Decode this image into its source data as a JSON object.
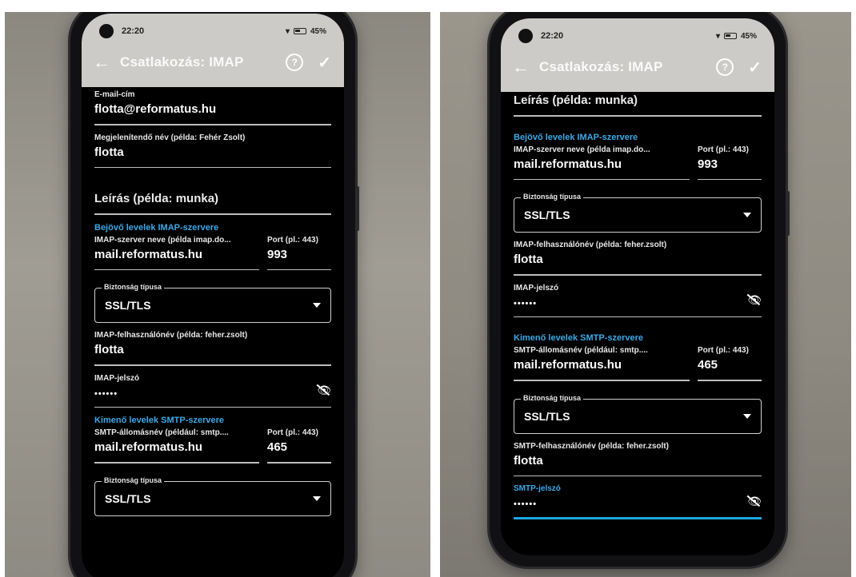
{
  "app": {
    "time": "22:20",
    "battery": "45%",
    "title": "Csatlakozás: IMAP"
  },
  "fields": {
    "email_label": "E-mail-cím",
    "email_value": "flotta@reformatus.hu",
    "display_name_label": "Megjelenítendő név (példa: Fehér Zsolt)",
    "display_name_value": "flotta",
    "description_placeholder": "Leírás (példa: munka)"
  },
  "incoming": {
    "section_title": "Bejövő levelek IMAP-szervere",
    "server_label": "IMAP-szerver neve (példa imap.do...",
    "server_value": "mail.reformatus.hu",
    "port_label": "Port (pl.: 443)",
    "port_value": "993",
    "security_legend": "Biztonság típusa",
    "security_value": "SSL/TLS",
    "username_label": "IMAP-felhasználónév (példa: feher.zsolt)",
    "username_value": "flotta",
    "password_label": "IMAP-jelszó",
    "password_dots": "••••••"
  },
  "outgoing": {
    "section_title": "Kimenő levelek SMTP-szervere",
    "server_label": "SMTP-állomásnév (például: smtp....",
    "server_value": "mail.reformatus.hu",
    "port_label": "Port (pl.: 443)",
    "port_value": "465",
    "security_legend": "Biztonság típusa",
    "security_value": "SSL/TLS",
    "username_label": "SMTP-felhasználónév (példa: feher.zsolt)",
    "username_value": "flotta",
    "password_label": "SMTP-jelszó",
    "password_dots": "••••••"
  },
  "colors": {
    "accent": "#3aa9e8",
    "screen_bg": "#000000",
    "appbar_bg": "#cdcbc8"
  }
}
